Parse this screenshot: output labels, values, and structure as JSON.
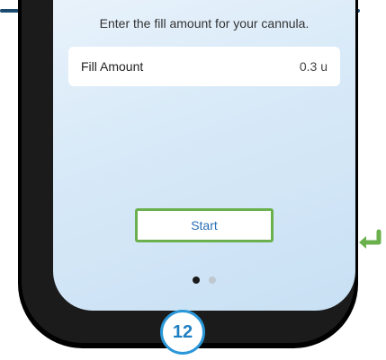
{
  "screen": {
    "instruction": "Enter the fill amount for your cannula.",
    "fill_amount": {
      "label": "Fill Amount",
      "value": "0.3 u"
    },
    "start_button_label": "Start",
    "pagination": {
      "current_page": 1,
      "total_pages": 2
    }
  },
  "annotation": {
    "step_number": "12",
    "highlight_color": "#6ab04c",
    "badge_color": "#2a97d8",
    "return_icon": "return-arrow-icon"
  }
}
